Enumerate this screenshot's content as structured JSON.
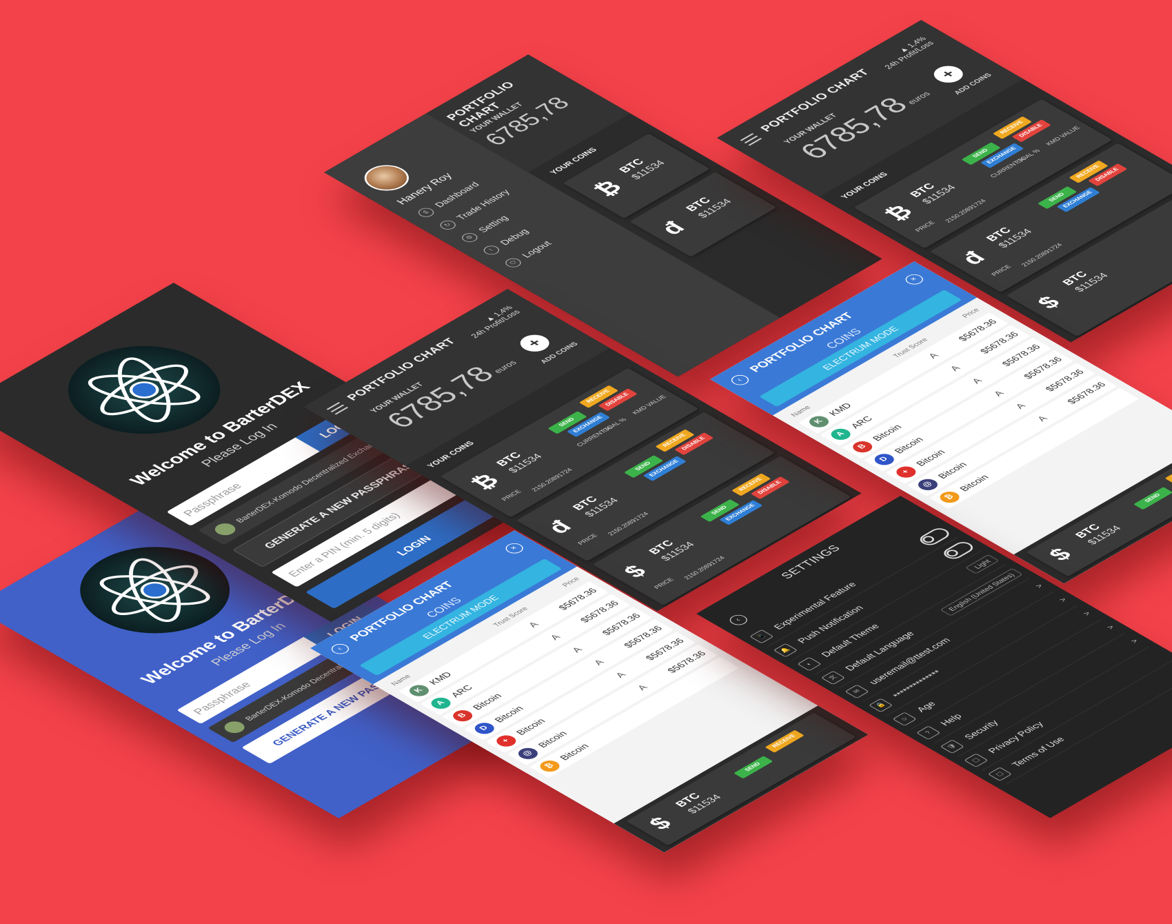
{
  "colors": {
    "background": "#f4424a",
    "dark": "#2b2b2b",
    "blue": "#4161c9",
    "accent": "#2d6dc5"
  },
  "login": {
    "title": "Welcome to BarterDEX",
    "subtitle": "Please Log In",
    "passphrase_placeholder": "Passphrase",
    "login_label": "LOGIN",
    "exchange_select": "BarterDEX-Komodo Decentralized Exchange",
    "generate_label": "GENERATE A NEW PASSPHRASE",
    "pin_placeholder": "Enter a PIN (min. 5 digits)"
  },
  "portfolio": {
    "title": "PORTFOLIO CHART",
    "wallet_label": "YOUR WALLET",
    "wallet_value": "6785,78",
    "wallet_unit": "euros",
    "change": "1,4%",
    "change_label": "24h Profit/Loss",
    "add_coins": "ADD COINS",
    "your_coins": "YOUR COINS",
    "coins": [
      {
        "symbol": "₿",
        "name": "BTC",
        "value": "$11534",
        "price_label": "PRICE",
        "price": "2150.20891724"
      },
      {
        "symbol": "đ",
        "name": "BTC",
        "value": "$11534",
        "price_label": "PRICE",
        "price": "2150.20891724"
      },
      {
        "symbol": "$",
        "name": "BTC",
        "value": "$11534",
        "price_label": "PRICE",
        "price": "2150.20891724"
      }
    ],
    "labels": {
      "current": "CURRENT %",
      "goal": "GOAL %",
      "kmd": "KMD VALUE",
      "zero": "0"
    },
    "buttons": {
      "send": "SEND",
      "receive": "RECEIVE",
      "exchange": "EXCHANGE",
      "disable": "DISABLE"
    }
  },
  "menu": {
    "user": "Hanery Roy",
    "items": [
      "Dashboard",
      "Trade History",
      "Setting",
      "Debug",
      "Logout"
    ]
  },
  "electrum": {
    "title": "PORTFOLIO CHART",
    "coins_label": "COINS",
    "mode": "ELECTRUM MODE",
    "headers": {
      "name": "Name",
      "trust": "Trust Score",
      "price": "Price"
    },
    "rows": [
      {
        "name": "KMD",
        "trust": "A",
        "price": "$5678.36",
        "color": "#5f8f6f",
        "glyph": "K"
      },
      {
        "name": "ARC",
        "trust": "A",
        "price": "$5678.36",
        "color": "#1fb58f",
        "glyph": "A"
      },
      {
        "name": "Bitcoin",
        "trust": "A",
        "price": "$5678.36",
        "color": "#d9342b",
        "glyph": "B"
      },
      {
        "name": "Bitcoin",
        "trust": "A",
        "price": "$5678.36",
        "color": "#2f55c8",
        "glyph": "D"
      },
      {
        "name": "Bitcoin",
        "trust": "A",
        "price": "$5678.36",
        "color": "#e0302b",
        "glyph": "+"
      },
      {
        "name": "Bitcoin",
        "trust": "A",
        "price": "$5678.36",
        "color": "#3a3f7a",
        "glyph": "@"
      },
      {
        "name": "Bitcoin",
        "trust": "",
        "price": "",
        "color": "#f39a1b",
        "glyph": "₿"
      }
    ]
  },
  "settings": {
    "title": "SETTINGS",
    "rows": [
      {
        "label": "Experimental Feature",
        "control": "toggle"
      },
      {
        "label": "Push Notification",
        "control": "toggle"
      },
      {
        "label": "Default Theme",
        "control": "Light"
      },
      {
        "label": "Default Language",
        "control": "English (United States)"
      },
      {
        "label": "useremail@ttest.com",
        "control": ">"
      },
      {
        "label": "**************",
        "control": ">"
      },
      {
        "label": "Age",
        "control": ">"
      },
      {
        "label": "Help",
        "control": ">"
      },
      {
        "label": "Security",
        "control": ">"
      },
      {
        "label": "Privacy Policy",
        "control": ""
      },
      {
        "label": "Terms of Use",
        "control": ""
      }
    ]
  }
}
